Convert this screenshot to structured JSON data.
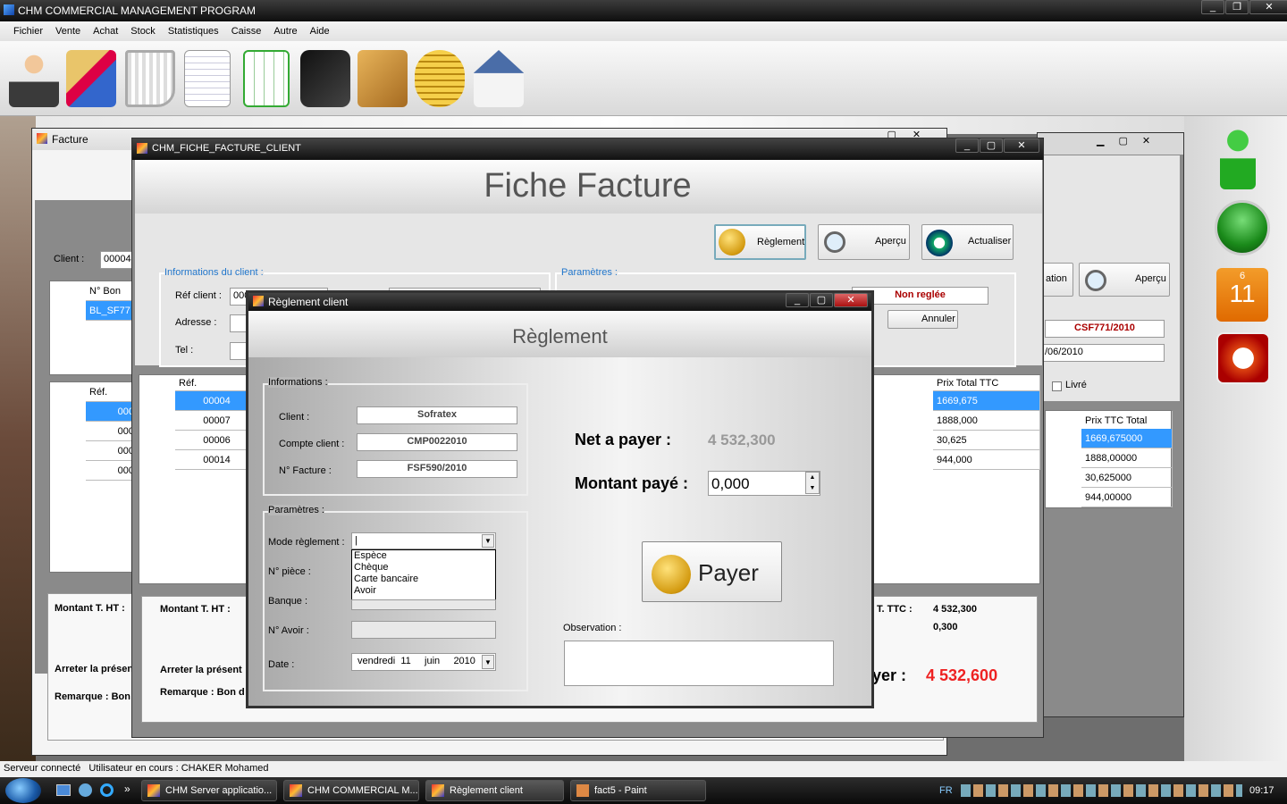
{
  "app": {
    "title": "CHM COMMERCIAL MANAGEMENT PROGRAM"
  },
  "menu": [
    "Fichier",
    "Vente",
    "Achat",
    "Stock",
    "Statistiques",
    "Caisse",
    "Autre",
    "Aide"
  ],
  "toolbar_icons": [
    "user-icon",
    "folders-icon",
    "cart-icon",
    "document-icon",
    "spreadsheet-icon",
    "wallet-icon",
    "box-icon",
    "coins-icon",
    "house-icon"
  ],
  "facture_window": {
    "title": "Facture",
    "client_label": "Client :",
    "client_value": "00004",
    "grid1_header": "N° Bon de",
    "grid1_row": "BL_SF77",
    "grid2_header": "Réf.",
    "grid2_rows": [
      "000",
      "000",
      "000",
      "000"
    ],
    "montant_ht": "Montant T. HT :",
    "arreter": "Arreter la présen",
    "remarque": "Remarque : Bon"
  },
  "back_window": {
    "apercu": "Aperçu",
    "ation": "ation",
    "facture_num": "CSF771/2010",
    "date": "/06/2010",
    "livre": "Livré",
    "col_header": "Prix TTC Total",
    "rows": [
      "1669,675000",
      "1888,00000",
      "30,625000",
      "944,00000"
    ]
  },
  "fiche_window": {
    "title": "CHM_FICHE_FACTURE_CLIENT",
    "heading": "Fiche Facture",
    "buttons": {
      "reglement": "Règlement",
      "apercu": "Aperçu",
      "actualiser": "Actualiser"
    },
    "info_group": "Informations du client :",
    "params_group": "Paramètres :",
    "ref_client": "Réf client :",
    "ref_value": "000",
    "adresse": "Adresse :",
    "tel": "Tel :",
    "status": "Non reglée",
    "annuler": "Annuler",
    "grid": {
      "col_ref": "Réf.",
      "col_prix": "Prix Total TTC",
      "rows": [
        {
          "ref": "00004",
          "prix": "1669,675"
        },
        {
          "ref": "00007",
          "prix": "1888,000"
        },
        {
          "ref": "00006",
          "prix": "30,625"
        },
        {
          "ref": "00014",
          "prix": "944,000"
        }
      ]
    },
    "montant_ht": "Montant T. HT :",
    "arreter": "Arreter la présent",
    "remarque": "Remarque : Bon d",
    "ttc_label": "rt T. TTC :",
    "ttc_value": "4 532,300",
    "tva_label": ":",
    "tva_value": "0,300",
    "net_label": "yer :",
    "net_value": "4 532,600"
  },
  "reglement_dialog": {
    "title": "Règlement client",
    "heading": "Règlement",
    "informations": "Informations :",
    "client_label": "Client :",
    "client_value": "Sofratex",
    "compte_label": "Compte client :",
    "compte_value": "CMP0022010",
    "facture_label": "N° Facture :",
    "facture_value": "FSF590/2010",
    "parametres": "Paramètres :",
    "mode_label": "Mode règlement :",
    "mode_options": [
      "Espèce",
      "Chèque",
      "Carte bancaire",
      "Avoir"
    ],
    "piece_label": "N° pièce :",
    "banque_label": "Banque :",
    "avoir_label": "N° Avoir :",
    "date_label": "Date :",
    "date_day": "vendredi",
    "date_num": "11",
    "date_month": "juin",
    "date_year": "2010",
    "net_label": "Net a payer :",
    "net_value": "4 532,300",
    "montant_label": "Montant payé :",
    "montant_value": "0,000",
    "payer": "Payer",
    "observation": "Observation :"
  },
  "sidebar_right": {
    "calendar_top": "6",
    "calendar_day": "11"
  },
  "status": {
    "server": "Serveur connecté",
    "user": "Utilisateur en cours : CHAKER Mohamed"
  },
  "taskbar": {
    "tasks": [
      "CHM Server applicatio...",
      "CHM COMMERCIAL M...",
      "Règlement client",
      "fact5 - Paint"
    ],
    "lang": "FR",
    "time": "09:17"
  }
}
